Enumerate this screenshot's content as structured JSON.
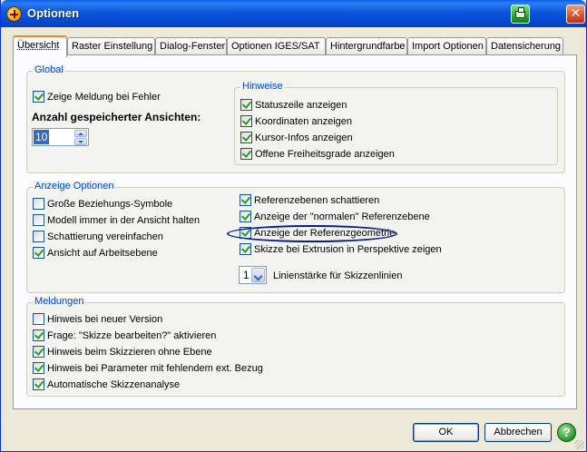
{
  "window": {
    "title": "Optionen"
  },
  "tabs": [
    {
      "label": "Übersicht",
      "active": true
    },
    {
      "label": "Raster Einstellung"
    },
    {
      "label": "Dialog-Fenster"
    },
    {
      "label": "Optionen IGES/SAT"
    },
    {
      "label": "Hintergrundfarbe"
    },
    {
      "label": "Import Optionen"
    },
    {
      "label": "Datensicherung"
    }
  ],
  "global": {
    "legend": "Global",
    "zeige_meldung": {
      "label": "Zeige Meldung bei Fehler",
      "checked": true
    },
    "anzahl_label": "Anzahl gespeicherter Ansichten:",
    "anzahl_value": "10",
    "hinweise": {
      "legend": "Hinweise",
      "items": [
        {
          "label": "Statuszeile anzeigen",
          "checked": true
        },
        {
          "label": "Koordinaten anzeigen",
          "checked": true
        },
        {
          "label": "Kursor-Infos anzeigen",
          "checked": true
        },
        {
          "label": "Offene Freiheitsgrade anzeigen",
          "checked": true
        }
      ]
    }
  },
  "anzeige": {
    "legend": "Anzeige Optionen",
    "left": [
      {
        "label": "Große Beziehungs-Symbole",
        "checked": false
      },
      {
        "label": "Modell immer in der Ansicht halten",
        "checked": false
      },
      {
        "label": "Schattierung vereinfachen",
        "checked": false
      },
      {
        "label": "Ansicht auf Arbeitsebene",
        "checked": true
      }
    ],
    "right": [
      {
        "label": "Referenzebenen schattieren",
        "checked": true
      },
      {
        "label": "Anzeige der \"normalen\" Referenzebene",
        "checked": true
      },
      {
        "label": "Anzeige der Referenzgeometrie",
        "checked": true
      },
      {
        "label": "Skizze bei Extrusion in Perspektive zeigen",
        "checked": true
      }
    ],
    "linienstaerke_value": "1",
    "linienstaerke_label": "Linienstärke für Skizzenlinien"
  },
  "meldungen": {
    "legend": "Meldungen",
    "items": [
      {
        "label": "Hinweis bei neuer Version",
        "checked": false
      },
      {
        "label": "Frage: \"Skizze bearbeiten?\" aktivieren",
        "checked": true
      },
      {
        "label": "Hinweis beim Skizzieren ohne Ebene",
        "checked": true
      },
      {
        "label": "Hinweis bei Parameter mit fehlendem ext. Bezug",
        "checked": true
      },
      {
        "label": "Automatische Skizzenanalyse",
        "checked": true
      }
    ]
  },
  "buttons": {
    "ok": "OK",
    "cancel": "Abbrechen",
    "help": "?"
  },
  "icons": {
    "app": "app-logo-icon",
    "print": "print-icon",
    "close": "close-icon",
    "help": "help-icon"
  }
}
